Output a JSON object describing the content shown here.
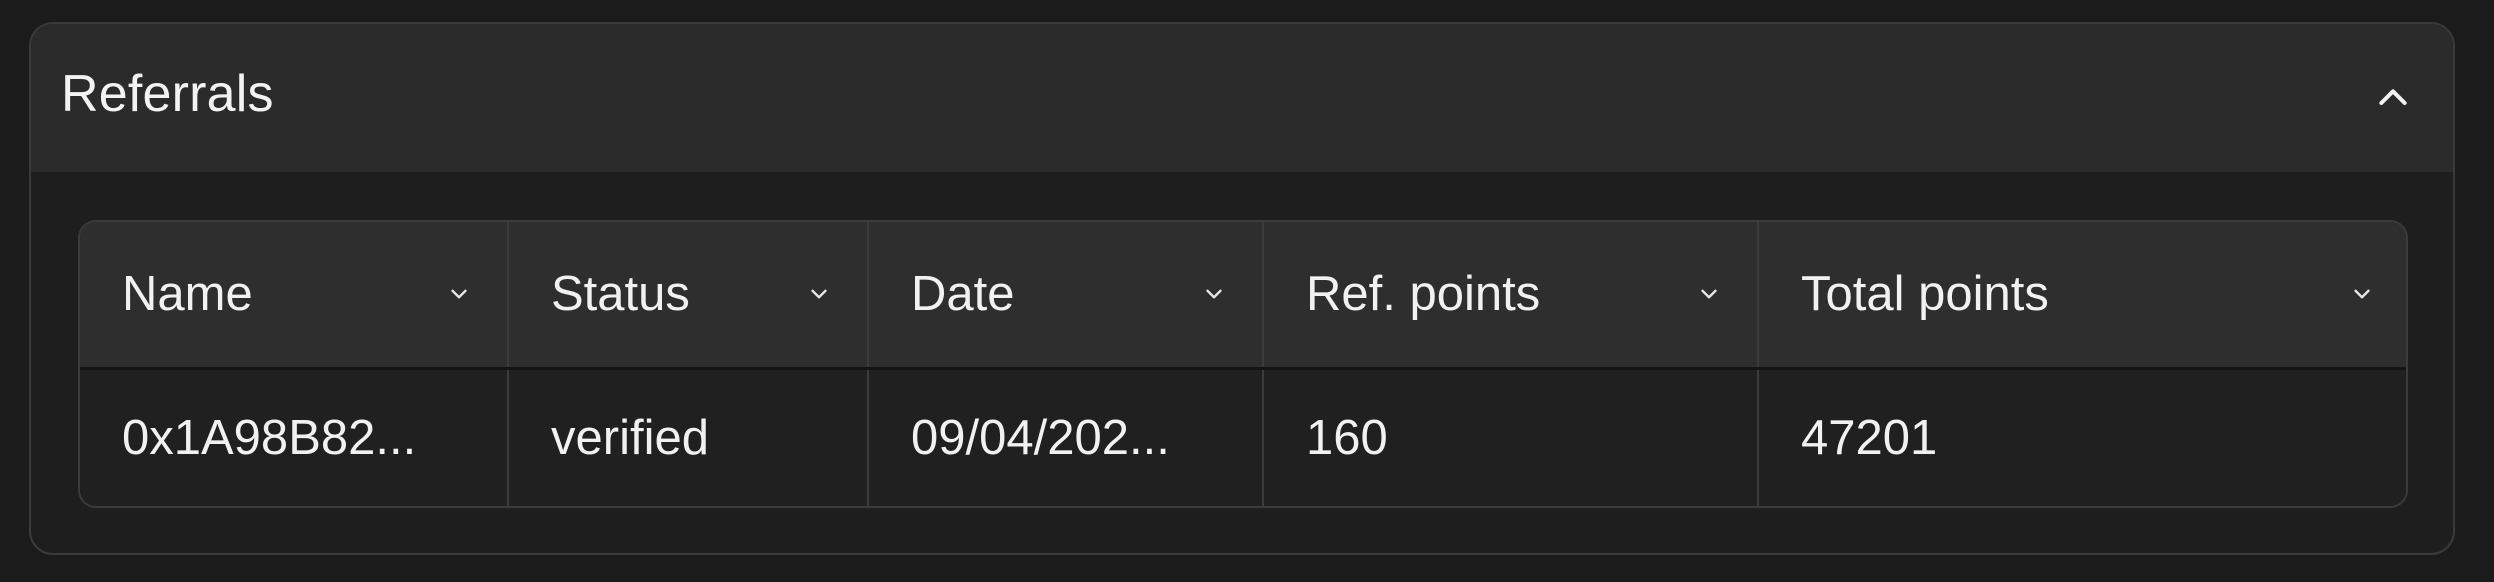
{
  "panel": {
    "title": "Referrals",
    "collapse_icon": "chevron-up-icon"
  },
  "table": {
    "columns": [
      {
        "label": "Name",
        "sort_icon": "chevron-down-icon"
      },
      {
        "label": "Status",
        "sort_icon": "chevron-down-icon"
      },
      {
        "label": "Date",
        "sort_icon": "chevron-down-icon"
      },
      {
        "label": "Ref. points",
        "sort_icon": "chevron-down-icon"
      },
      {
        "label": "Total points",
        "sort_icon": "chevron-down-icon"
      }
    ],
    "rows": [
      {
        "name": "0x1A98B82...",
        "status": "verified",
        "date": "09/04/202...",
        "ref_points": "160",
        "total_points": "47201"
      }
    ]
  },
  "colors": {
    "background": "#1b1b1b",
    "panel_header": "#2b2b2b",
    "table_header": "#2e2e2e",
    "text": "#f1f1f1",
    "border": "#3b3b3b"
  }
}
